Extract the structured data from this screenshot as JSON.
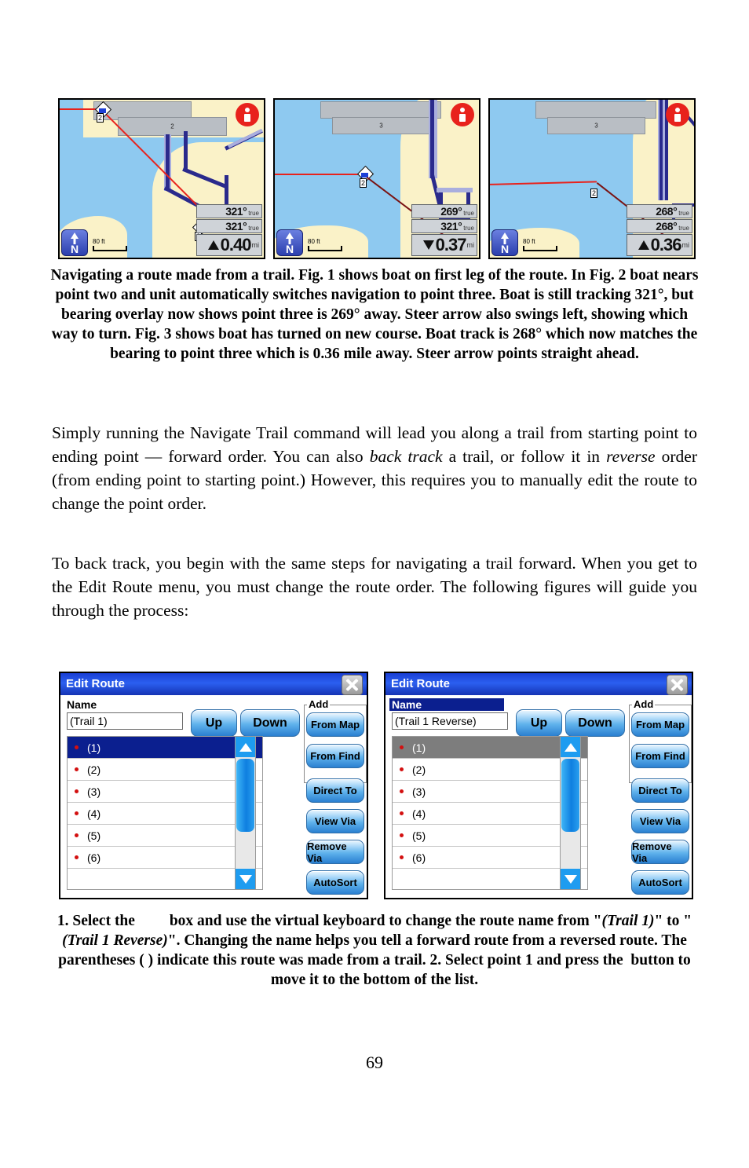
{
  "page": {
    "number": "69"
  },
  "figures": [
    {
      "name": "fig-1",
      "bearing": "321°",
      "bearing_unit": "true",
      "track": "321°",
      "track_unit": "true",
      "distance": "0.40",
      "distance_unit": "mi",
      "steer_direction": "up",
      "scale": "80 ft",
      "compass_label": "N",
      "waypoint_label": "2",
      "waypoint_label_2": "1",
      "gray_block_label": "2"
    },
    {
      "name": "fig-2",
      "bearing": "269°",
      "bearing_unit": "true",
      "track": "321°",
      "track_unit": "true",
      "distance": "0.37",
      "distance_unit": "mi",
      "steer_direction": "down",
      "scale": "80 ft",
      "compass_label": "N",
      "waypoint_label": "2",
      "gray_block_label": "3"
    },
    {
      "name": "fig-3",
      "bearing": "268°",
      "bearing_unit": "true",
      "track": "268°",
      "track_unit": "true",
      "distance": "0.36",
      "distance_unit": "mi",
      "steer_direction": "up",
      "scale": "80 ft",
      "compass_label": "N",
      "waypoint_label": "2",
      "gray_block_label": "3"
    }
  ],
  "figure_caption": "Navigating a route made from a trail. Fig. 1 shows boat on first leg of the route. In Fig. 2 boat nears point two and unit automatically switches navigation to point three. Boat is still tracking 321°, but bearing overlay now shows point three is 269° away. Steer arrow also swings left, showing which way to turn. Fig. 3 shows boat has turned on new course. Boat track is 268° which now matches the bearing to point three which is 0.36 mile away. Steer arrow points straight ahead.",
  "paragraph_1": {
    "t1": "Simply running the Navigate Trail command will lead you along a trail from starting point to ending point — forward order. You can also ",
    "i1": "back track",
    "t2": " a trail, or follow it in ",
    "i2": "reverse",
    "t3": " order (from ending point to starting point.) However, this requires you to manually edit the route to change the point order."
  },
  "paragraph_2": "To back track, you begin with the same steps for navigating a trail forward. When you get to the Edit Route menu, you must change the route order. The following figures will guide you through the process:",
  "dialogs": [
    {
      "name": "edit-route-forward",
      "title": "Edit Route",
      "name_label": "Name",
      "name_value": "(Trail 1)",
      "name_label_selected": false,
      "up_label": "Up",
      "down_label": "Down",
      "add_group_label": "Add",
      "buttons": [
        "From Map",
        "From Find",
        "Direct To",
        "View Via",
        "Remove Via",
        "AutoSort"
      ],
      "points": [
        "(1)",
        "(2)",
        "(3)",
        "(4)",
        "(5)",
        "(6)"
      ],
      "selected_index": 0,
      "selection_style": "blue"
    },
    {
      "name": "edit-route-reverse",
      "title": "Edit Route",
      "name_label": "Name",
      "name_value": "(Trail 1 Reverse)",
      "name_label_selected": true,
      "up_label": "Up",
      "down_label": "Down",
      "add_group_label": "Add",
      "buttons": [
        "From Map",
        "From Find",
        "Direct To",
        "View Via",
        "Remove Via",
        "AutoSort"
      ],
      "points": [
        "(1)",
        "(2)",
        "(3)",
        "(4)",
        "(5)",
        "(6)"
      ],
      "selected_index": 0,
      "selection_style": "gray"
    }
  ],
  "dialog_caption": {
    "part1": "1. Select the",
    "gap1": "        ",
    "part2": " box and use the virtual keyboard to change the route name from \"",
    "italic1": "(Trail 1)",
    "part3": "\" to \"",
    "italic2": "(Trail 1 Reverse)",
    "part4": "\". Changing the name helps you tell a forward route from a reversed route. The parentheses ( ) indicate this route was made from a trail.  2. Select point 1 and press the",
    "gap2": " ",
    "part5": " button to move it to the bottom of the list."
  },
  "colors": {
    "water": "#8ec9f0",
    "land": "#faf2c8",
    "route_line": "#e8221c",
    "title_blue": "#1a3fd4",
    "selection_blue": "#0b1f8f",
    "selection_gray": "#7d7d7d",
    "info_red": "#e8221c"
  }
}
